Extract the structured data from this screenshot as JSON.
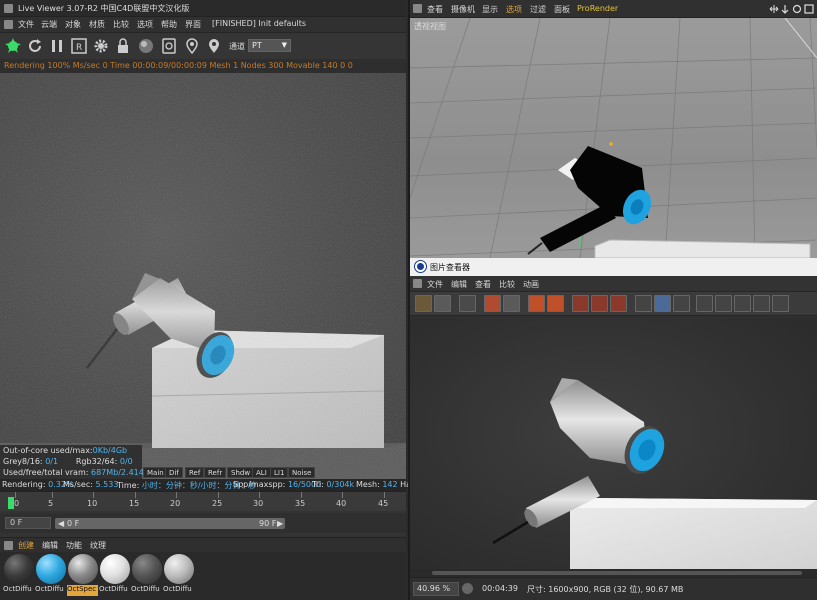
{
  "live_viewer": {
    "title": "Live Viewer 3.07-R2 中国C4D联盟中文汉化版",
    "status": "[FINISHED] Init defaults",
    "menu": [
      "文件",
      "云端",
      "对象",
      "材质",
      "比较",
      "选项",
      "帮助",
      "界面"
    ],
    "kernel_label": "通道",
    "kernel_value": "PT",
    "top_status": "Rendering 100%  Ms/sec 0  Time 00:00:09/00:00:09  Mesh 1 Nodes 300 Movable 140  0 0",
    "hud": {
      "out_of_core_label": "Out-of-core used/max:",
      "out_of_core_value": "0Kb/4Gb",
      "grey_label": "Grey8/16:",
      "grey_value": "0/1",
      "rgb_label": "Rgb32/64:",
      "rgb_value": "0/0",
      "vram_label": "Used/free/total vram:",
      "vram_value": "687Mb/2.414Gb/4Gb"
    },
    "pass_tabs": [
      "Main",
      "Dif",
      "Ref",
      "Refr",
      "Shdw",
      "ALI",
      "LI1",
      "Noise"
    ],
    "bottom_status": {
      "rendering_label": "Rendering:",
      "rendering_value": "0.32%",
      "ms_label": "Ms/sec:",
      "ms_value": "5.533",
      "time_label": "Time:",
      "time_value": "小时：分钟：秒/小时：分钟：秒",
      "spp_label": "Spp/maxspp:",
      "spp_value": "16/5000",
      "tri_label": "Tri:",
      "tri_value": "0/304k",
      "mesh_label": "Mesh:",
      "mesh_value": "142",
      "hair_label": "Hai"
    }
  },
  "timeline": {
    "ticks": [
      "0",
      "5",
      "10",
      "15",
      "20",
      "25",
      "30",
      "35",
      "40",
      "45"
    ],
    "current_frame": "0 F",
    "range_start": "0 F",
    "range_end": "90 F"
  },
  "material_manager": {
    "menu": [
      "创建",
      "编辑",
      "功能",
      "纹理"
    ],
    "materials": [
      {
        "name": "OctDiffu",
        "color": "#3b3b3b"
      },
      {
        "name": "OctDiffu",
        "color": "#2fa9e0"
      },
      {
        "name": "OctSpec",
        "color": "#8a8a8a"
      },
      {
        "name": "OctDiffu",
        "color": "#e8e8e8"
      },
      {
        "name": "OctDiffu",
        "color": "#555555"
      },
      {
        "name": "OctDiffu",
        "color": "#bdbdbd"
      }
    ]
  },
  "viewport": {
    "menu": [
      "查看",
      "摄像机",
      "显示",
      "选项",
      "过滤",
      "面板",
      "ProRender"
    ],
    "label": "透视视图"
  },
  "picture_viewer": {
    "title": "图片查看器",
    "menu": [
      "文件",
      "编辑",
      "查看",
      "比较",
      "动画"
    ],
    "zoom": "40.96 %",
    "time": "00:04:39",
    "size_info": "尺寸: 1600x900, RGB (32 位), 90.67 MB"
  },
  "colors": {
    "accent_orange": "#e3a63b",
    "value_blue": "#4fb4f0",
    "timeline_green": "#3adb6a",
    "fan_blue": "#2aa6e0"
  }
}
